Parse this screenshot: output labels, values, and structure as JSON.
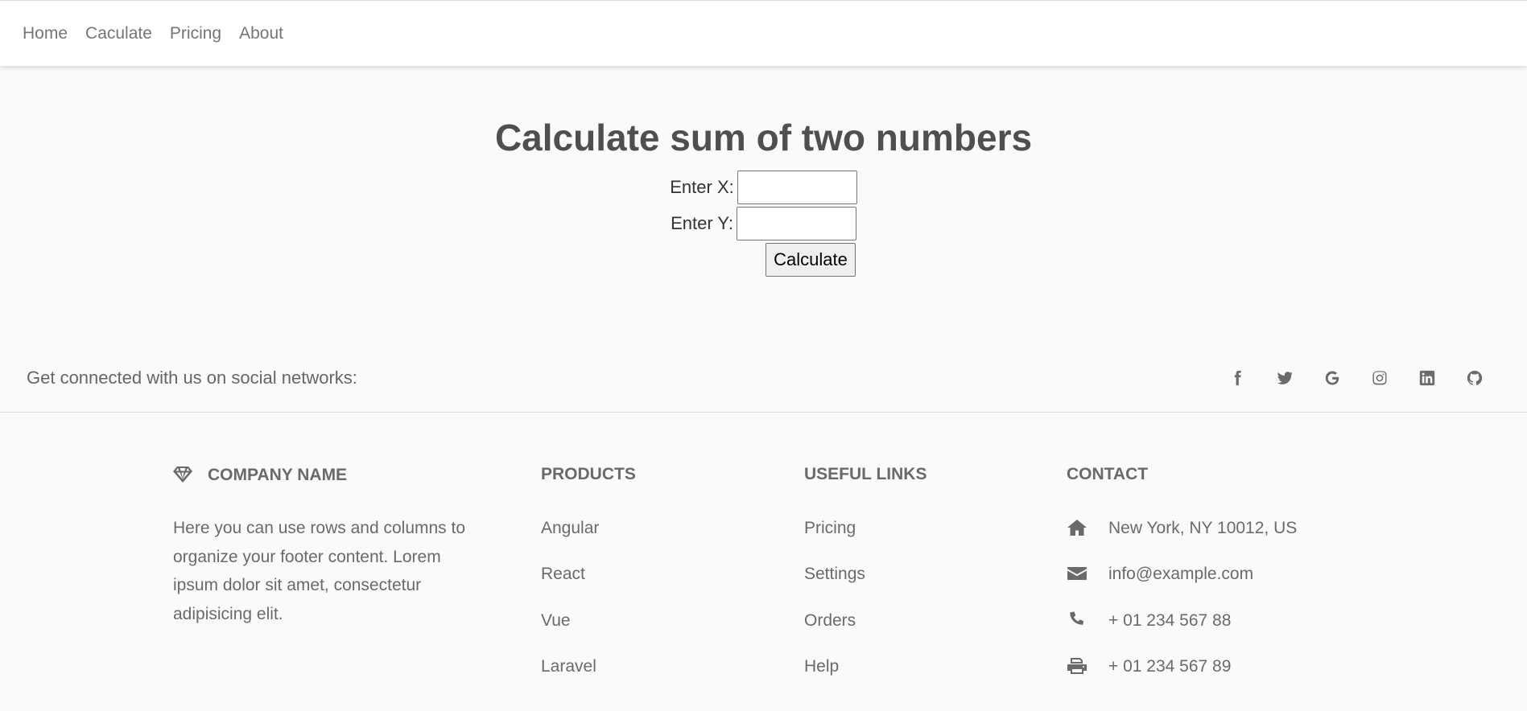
{
  "nav": {
    "items": [
      {
        "label": "Home"
      },
      {
        "label": "Caculate"
      },
      {
        "label": "Pricing"
      },
      {
        "label": "About"
      }
    ]
  },
  "main": {
    "title": "Calculate sum of two numbers",
    "x_label": "Enter X:",
    "y_label": "Enter Y:",
    "x_value": "",
    "y_value": "",
    "button_label": "Calculate"
  },
  "social": {
    "text": "Get connected with us on social networks:",
    "icons": [
      "facebook-icon",
      "twitter-icon",
      "google-icon",
      "instagram-icon",
      "linkedin-icon",
      "github-icon"
    ]
  },
  "footer": {
    "company": {
      "heading": "COMPANY NAME",
      "icon": "gem-icon",
      "description": "Here you can use rows and columns to organize your footer content. Lorem ipsum dolor sit amet, consectetur adipisicing elit."
    },
    "products": {
      "heading": "PRODUCTS",
      "items": [
        "Angular",
        "React",
        "Vue",
        "Laravel"
      ]
    },
    "links": {
      "heading": "USEFUL LINKS",
      "items": [
        "Pricing",
        "Settings",
        "Orders",
        "Help"
      ]
    },
    "contact": {
      "heading": "CONTACT",
      "items": [
        {
          "icon": "home-icon",
          "text": "New York, NY 10012, US"
        },
        {
          "icon": "envelope-icon",
          "text": "info@example.com"
        },
        {
          "icon": "phone-icon",
          "text": "+ 01 234 567 88"
        },
        {
          "icon": "print-icon",
          "text": "+ 01 234 567 89"
        }
      ]
    }
  }
}
